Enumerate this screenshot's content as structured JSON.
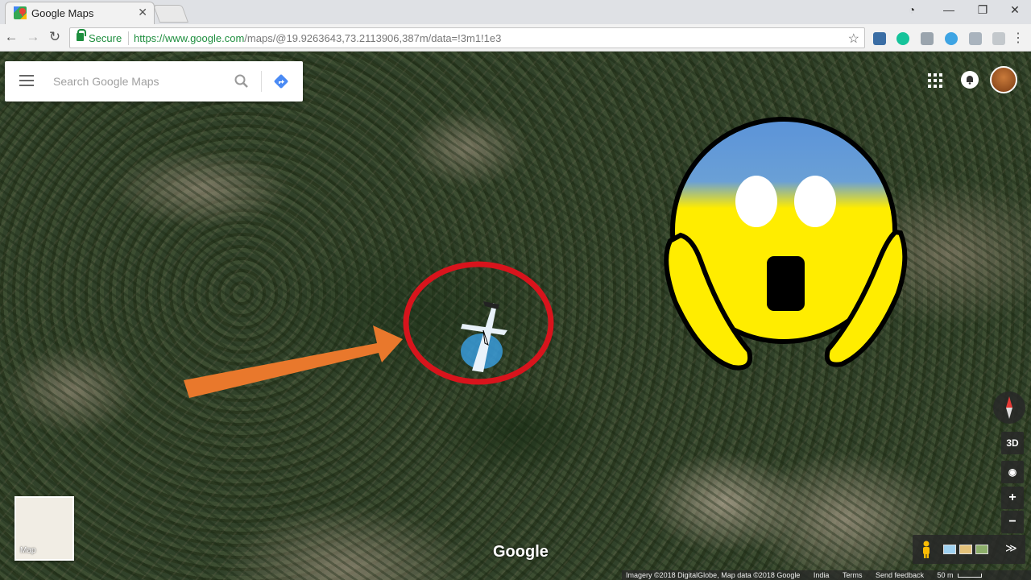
{
  "browser": {
    "tab_title": "Google Maps",
    "close_glyph": "✕",
    "window_controls": [
      "◔",
      "—",
      "❐",
      "✕"
    ],
    "nav": {
      "back": "←",
      "forward": "→",
      "reload": "↻"
    },
    "secure_label": "Secure",
    "url_host": "https://www.google.com",
    "url_path": "/maps/@19.9263643,73.2113906,387m/data=!3m1!1e3",
    "bookmark_glyph": "☆",
    "menu_glyph": "⋮",
    "extensions": [
      "news-icon",
      "grammarly-icon",
      "extension-icon",
      "vpn-icon",
      "extension-icon-2",
      "extension-icon-3"
    ]
  },
  "maps": {
    "search_placeholder": "Search Google Maps",
    "minimap_label": "Map",
    "logo_text": "Google",
    "controls": {
      "three_d": "3D",
      "zoom_in": "+",
      "zoom_out": "−",
      "location": "◉",
      "expand": "≫"
    },
    "footer": {
      "attribution": "Imagery ©2018 DigitalGlobe, Map data ©2018 Google",
      "country": "India",
      "terms": "Terms",
      "feedback": "Send feedback",
      "scale": "50 m"
    }
  },
  "colors": {
    "arrow": "#e9782c",
    "circle": "#d8141c",
    "emoji_yellow": "#ffed00",
    "emoji_blue": "#5b93d9",
    "plane": "#3aa1e6",
    "secure_green": "#1e8e3e"
  }
}
